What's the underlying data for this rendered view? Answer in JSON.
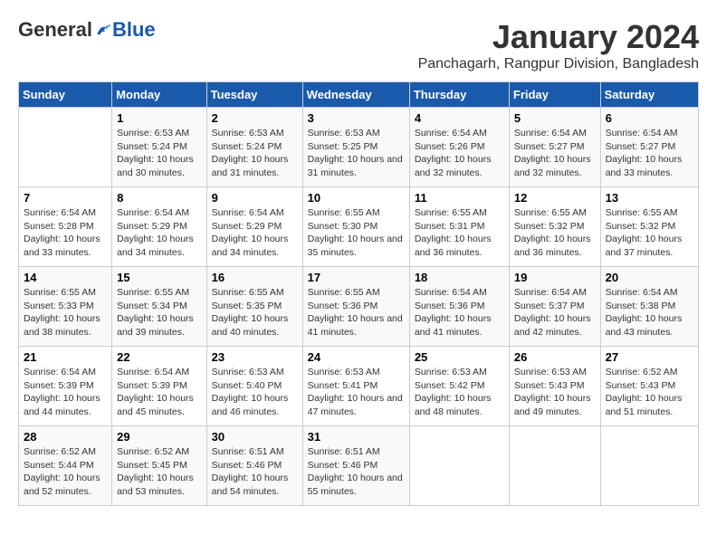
{
  "logo": {
    "general": "General",
    "blue": "Blue"
  },
  "title": "January 2024",
  "subtitle": "Panchagarh, Rangpur Division, Bangladesh",
  "days_of_week": [
    "Sunday",
    "Monday",
    "Tuesday",
    "Wednesday",
    "Thursday",
    "Friday",
    "Saturday"
  ],
  "weeks": [
    [
      {
        "day": "",
        "sunrise": "",
        "sunset": "",
        "daylight": ""
      },
      {
        "day": "1",
        "sunrise": "Sunrise: 6:53 AM",
        "sunset": "Sunset: 5:24 PM",
        "daylight": "Daylight: 10 hours and 30 minutes."
      },
      {
        "day": "2",
        "sunrise": "Sunrise: 6:53 AM",
        "sunset": "Sunset: 5:24 PM",
        "daylight": "Daylight: 10 hours and 31 minutes."
      },
      {
        "day": "3",
        "sunrise": "Sunrise: 6:53 AM",
        "sunset": "Sunset: 5:25 PM",
        "daylight": "Daylight: 10 hours and 31 minutes."
      },
      {
        "day": "4",
        "sunrise": "Sunrise: 6:54 AM",
        "sunset": "Sunset: 5:26 PM",
        "daylight": "Daylight: 10 hours and 32 minutes."
      },
      {
        "day": "5",
        "sunrise": "Sunrise: 6:54 AM",
        "sunset": "Sunset: 5:27 PM",
        "daylight": "Daylight: 10 hours and 32 minutes."
      },
      {
        "day": "6",
        "sunrise": "Sunrise: 6:54 AM",
        "sunset": "Sunset: 5:27 PM",
        "daylight": "Daylight: 10 hours and 33 minutes."
      }
    ],
    [
      {
        "day": "7",
        "sunrise": "Sunrise: 6:54 AM",
        "sunset": "Sunset: 5:28 PM",
        "daylight": "Daylight: 10 hours and 33 minutes."
      },
      {
        "day": "8",
        "sunrise": "Sunrise: 6:54 AM",
        "sunset": "Sunset: 5:29 PM",
        "daylight": "Daylight: 10 hours and 34 minutes."
      },
      {
        "day": "9",
        "sunrise": "Sunrise: 6:54 AM",
        "sunset": "Sunset: 5:29 PM",
        "daylight": "Daylight: 10 hours and 34 minutes."
      },
      {
        "day": "10",
        "sunrise": "Sunrise: 6:55 AM",
        "sunset": "Sunset: 5:30 PM",
        "daylight": "Daylight: 10 hours and 35 minutes."
      },
      {
        "day": "11",
        "sunrise": "Sunrise: 6:55 AM",
        "sunset": "Sunset: 5:31 PM",
        "daylight": "Daylight: 10 hours and 36 minutes."
      },
      {
        "day": "12",
        "sunrise": "Sunrise: 6:55 AM",
        "sunset": "Sunset: 5:32 PM",
        "daylight": "Daylight: 10 hours and 36 minutes."
      },
      {
        "day": "13",
        "sunrise": "Sunrise: 6:55 AM",
        "sunset": "Sunset: 5:32 PM",
        "daylight": "Daylight: 10 hours and 37 minutes."
      }
    ],
    [
      {
        "day": "14",
        "sunrise": "Sunrise: 6:55 AM",
        "sunset": "Sunset: 5:33 PM",
        "daylight": "Daylight: 10 hours and 38 minutes."
      },
      {
        "day": "15",
        "sunrise": "Sunrise: 6:55 AM",
        "sunset": "Sunset: 5:34 PM",
        "daylight": "Daylight: 10 hours and 39 minutes."
      },
      {
        "day": "16",
        "sunrise": "Sunrise: 6:55 AM",
        "sunset": "Sunset: 5:35 PM",
        "daylight": "Daylight: 10 hours and 40 minutes."
      },
      {
        "day": "17",
        "sunrise": "Sunrise: 6:55 AM",
        "sunset": "Sunset: 5:36 PM",
        "daylight": "Daylight: 10 hours and 41 minutes."
      },
      {
        "day": "18",
        "sunrise": "Sunrise: 6:54 AM",
        "sunset": "Sunset: 5:36 PM",
        "daylight": "Daylight: 10 hours and 41 minutes."
      },
      {
        "day": "19",
        "sunrise": "Sunrise: 6:54 AM",
        "sunset": "Sunset: 5:37 PM",
        "daylight": "Daylight: 10 hours and 42 minutes."
      },
      {
        "day": "20",
        "sunrise": "Sunrise: 6:54 AM",
        "sunset": "Sunset: 5:38 PM",
        "daylight": "Daylight: 10 hours and 43 minutes."
      }
    ],
    [
      {
        "day": "21",
        "sunrise": "Sunrise: 6:54 AM",
        "sunset": "Sunset: 5:39 PM",
        "daylight": "Daylight: 10 hours and 44 minutes."
      },
      {
        "day": "22",
        "sunrise": "Sunrise: 6:54 AM",
        "sunset": "Sunset: 5:39 PM",
        "daylight": "Daylight: 10 hours and 45 minutes."
      },
      {
        "day": "23",
        "sunrise": "Sunrise: 6:53 AM",
        "sunset": "Sunset: 5:40 PM",
        "daylight": "Daylight: 10 hours and 46 minutes."
      },
      {
        "day": "24",
        "sunrise": "Sunrise: 6:53 AM",
        "sunset": "Sunset: 5:41 PM",
        "daylight": "Daylight: 10 hours and 47 minutes."
      },
      {
        "day": "25",
        "sunrise": "Sunrise: 6:53 AM",
        "sunset": "Sunset: 5:42 PM",
        "daylight": "Daylight: 10 hours and 48 minutes."
      },
      {
        "day": "26",
        "sunrise": "Sunrise: 6:53 AM",
        "sunset": "Sunset: 5:43 PM",
        "daylight": "Daylight: 10 hours and 49 minutes."
      },
      {
        "day": "27",
        "sunrise": "Sunrise: 6:52 AM",
        "sunset": "Sunset: 5:43 PM",
        "daylight": "Daylight: 10 hours and 51 minutes."
      }
    ],
    [
      {
        "day": "28",
        "sunrise": "Sunrise: 6:52 AM",
        "sunset": "Sunset: 5:44 PM",
        "daylight": "Daylight: 10 hours and 52 minutes."
      },
      {
        "day": "29",
        "sunrise": "Sunrise: 6:52 AM",
        "sunset": "Sunset: 5:45 PM",
        "daylight": "Daylight: 10 hours and 53 minutes."
      },
      {
        "day": "30",
        "sunrise": "Sunrise: 6:51 AM",
        "sunset": "Sunset: 5:46 PM",
        "daylight": "Daylight: 10 hours and 54 minutes."
      },
      {
        "day": "31",
        "sunrise": "Sunrise: 6:51 AM",
        "sunset": "Sunset: 5:46 PM",
        "daylight": "Daylight: 10 hours and 55 minutes."
      },
      {
        "day": "",
        "sunrise": "",
        "sunset": "",
        "daylight": ""
      },
      {
        "day": "",
        "sunrise": "",
        "sunset": "",
        "daylight": ""
      },
      {
        "day": "",
        "sunrise": "",
        "sunset": "",
        "daylight": ""
      }
    ]
  ]
}
